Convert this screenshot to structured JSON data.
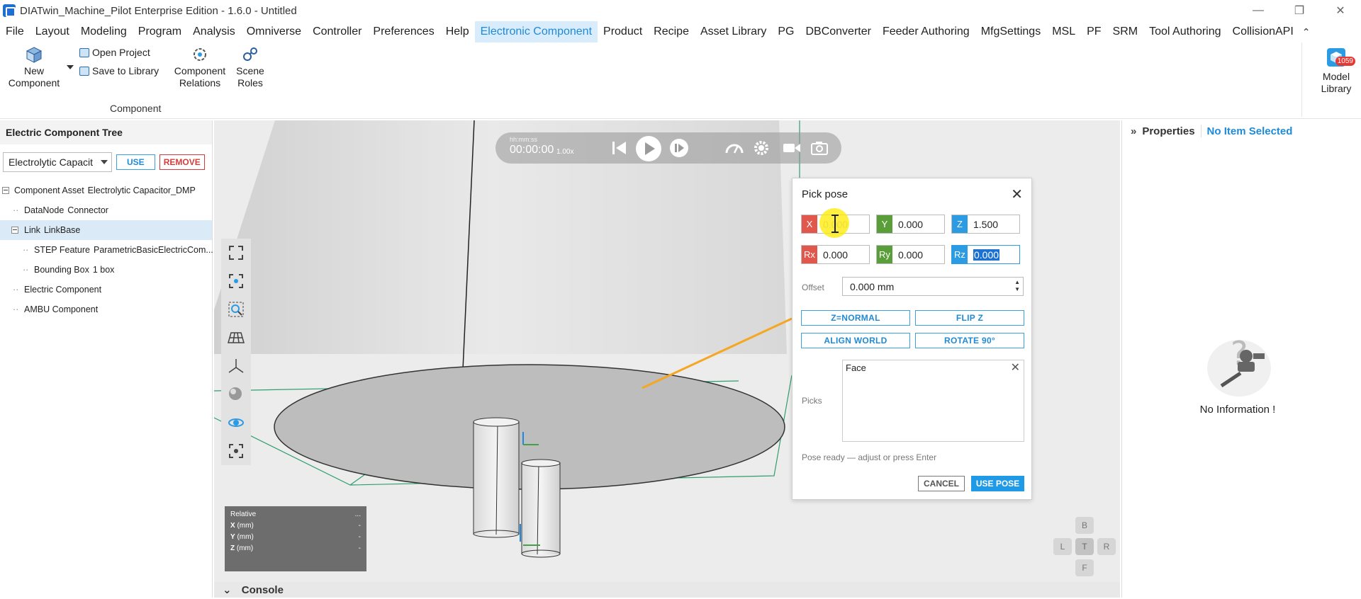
{
  "window": {
    "title": "DIATwin_Machine_Pilot Enterprise Edition - 1.6.0 - Untitled",
    "controls": [
      "—",
      "❐",
      "✕"
    ]
  },
  "menu": {
    "items": [
      "File",
      "Layout",
      "Modeling",
      "Program",
      "Analysis",
      "Omniverse",
      "Controller",
      "Preferences",
      "Help",
      "Electronic Component",
      "Product",
      "Recipe",
      "Asset Library",
      "PG",
      "DBConverter",
      "Feeder Authoring",
      "MfgSettings",
      "MSL",
      "PF",
      "SRM",
      "Tool Authoring",
      "CollisionAPI"
    ],
    "active": "Electronic Component"
  },
  "ribbon": {
    "new_component": "New\nComponent",
    "open_project": "Open Project",
    "save_to_library": "Save to Library",
    "component_relations": "Component\nRelations",
    "scene_roles": "Scene\nRoles",
    "group_label": "Component",
    "model_library": "Model\nLibrary",
    "model_library_badge": "1059"
  },
  "left_panel": {
    "title": "Electric Component Tree",
    "select_value": "Electrolytic Capacit",
    "use_label": "USE",
    "remove_label": "REMOVE",
    "tree": [
      {
        "type": "Component Asset",
        "name": "Electrolytic Capacitor_DMP"
      },
      {
        "type": "DataNode",
        "name": "Connector"
      },
      {
        "type": "Link",
        "name": "LinkBase"
      },
      {
        "type": "STEP Feature",
        "name": "ParametricBasicElectricCom..."
      },
      {
        "type": "Bounding Box",
        "name": "1 box"
      },
      {
        "type": "Electric Component",
        "name": ""
      },
      {
        "type": "AMBU Component",
        "name": ""
      }
    ]
  },
  "playbar": {
    "time_label": "hh:mm:ss",
    "time": "00:00:00",
    "speed": "1.00x"
  },
  "relative_box": {
    "title": "Relative",
    "more": "...",
    "rows": [
      {
        "label": "X",
        "unit": "(mm)",
        "value": "-"
      },
      {
        "label": "Y",
        "unit": "(mm)",
        "value": "-"
      },
      {
        "label": "Z",
        "unit": "(mm)",
        "value": "-"
      }
    ]
  },
  "navcube": {
    "top": "B",
    "left": "L",
    "center": "T",
    "right": "R",
    "bottom": "F"
  },
  "console": {
    "label": "Console",
    "chevron": "⌄"
  },
  "pick_pose": {
    "title": "Pick pose",
    "x_label": "X",
    "x_value": "0.000",
    "y_label": "Y",
    "y_value": "0.000",
    "z_label": "Z",
    "z_value": "1.500",
    "rx_label": "Rx",
    "rx_value": "0.000",
    "ry_label": "Ry",
    "ry_value": "0.000",
    "rz_label": "Rz",
    "rz_value": "0.000",
    "offset_label": "Offset",
    "offset_value": "0.000 mm",
    "btn_znormal": "Z=NORMAL",
    "btn_flipz": "FLIP Z",
    "btn_alignworld": "ALIGN WORLD",
    "btn_rotate90": "ROTATE 90°",
    "picks_label": "Picks",
    "pick_tag": "Face",
    "status": "Pose ready — adjust or press Enter",
    "cancel": "CANCEL",
    "use_pose": "USE POSE"
  },
  "properties": {
    "label": "Properties",
    "selection": "No Item Selected",
    "empty_text": "No Information !"
  },
  "colors": {
    "accent": "#1f8ad6",
    "active_menu_bg": "#d9ecfb",
    "remove_red": "#d63b3b",
    "x_axis": "#e2574c",
    "y_axis": "#5a9e3a",
    "z_axis": "#2b9be3",
    "pick_line": "#f5a623",
    "bbox_green": "#2f9e6e"
  }
}
